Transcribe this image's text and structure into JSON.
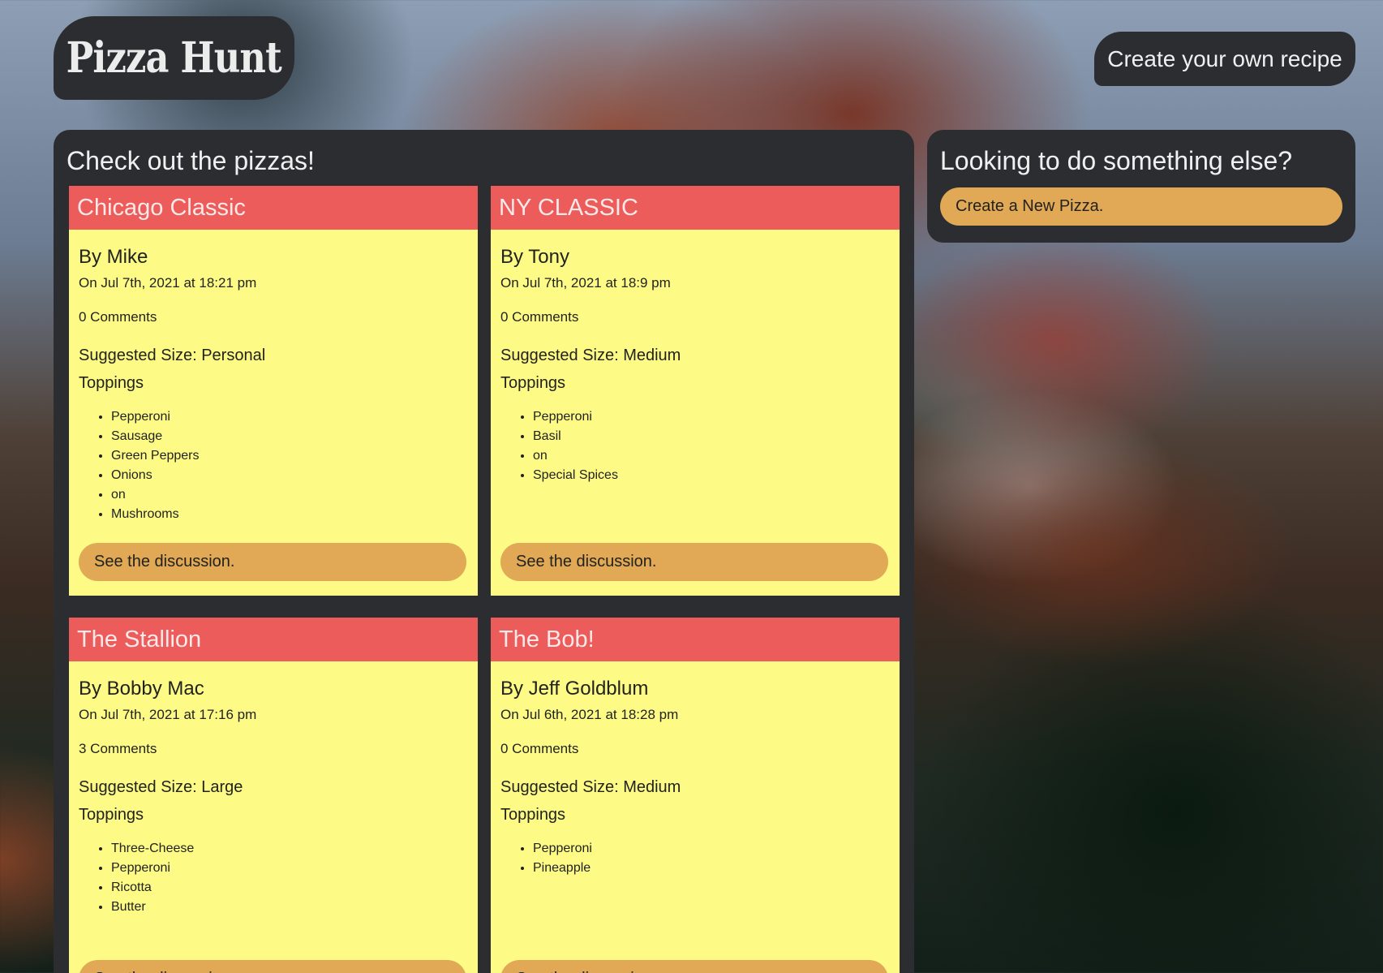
{
  "header": {
    "logo": "Pizza Hunt",
    "create_recipe_label": "Create your own recipe"
  },
  "main": {
    "title": "Check out the pizzas!",
    "pizzas": [
      {
        "name": "Chicago Classic",
        "author": "By Mike",
        "date": "On Jul 7th, 2021 at 18:21 pm",
        "comments": "0 Comments",
        "size": "Suggested Size: Personal",
        "toppings_label": "Toppings",
        "toppings": [
          "Pepperoni",
          "Sausage",
          "Green Peppers",
          "Onions",
          "on",
          "Mushrooms"
        ],
        "button": "See the discussion."
      },
      {
        "name": "NY CLASSIC",
        "author": "By Tony",
        "date": "On Jul 7th, 2021 at 18:9 pm",
        "comments": "0 Comments",
        "size": "Suggested Size: Medium",
        "toppings_label": "Toppings",
        "toppings": [
          "Pepperoni",
          "Basil",
          "on",
          "Special Spices"
        ],
        "button": "See the discussion."
      },
      {
        "name": "The Stallion",
        "author": "By Bobby Mac",
        "date": "On Jul 7th, 2021 at 17:16 pm",
        "comments": "3 Comments",
        "size": "Suggested Size: Large",
        "toppings_label": "Toppings",
        "toppings": [
          "Three-Cheese",
          "Pepperoni",
          "Ricotta",
          "Butter"
        ],
        "button": "See the discussion."
      },
      {
        "name": "The Bob!",
        "author": "By Jeff Goldblum",
        "date": "On Jul 6th, 2021 at 18:28 pm",
        "comments": "0 Comments",
        "size": "Suggested Size: Medium",
        "toppings_label": "Toppings",
        "toppings": [
          "Pepperoni",
          "Pineapple"
        ],
        "button": "See the discussion."
      }
    ]
  },
  "sidebar": {
    "title": "Looking to do something else?",
    "create_pizza_label": "Create a New Pizza."
  },
  "colors": {
    "panel": "#2b2d31",
    "card_header": "#ec5c5a",
    "card_body": "#fdfb86",
    "button": "#e1a855"
  }
}
